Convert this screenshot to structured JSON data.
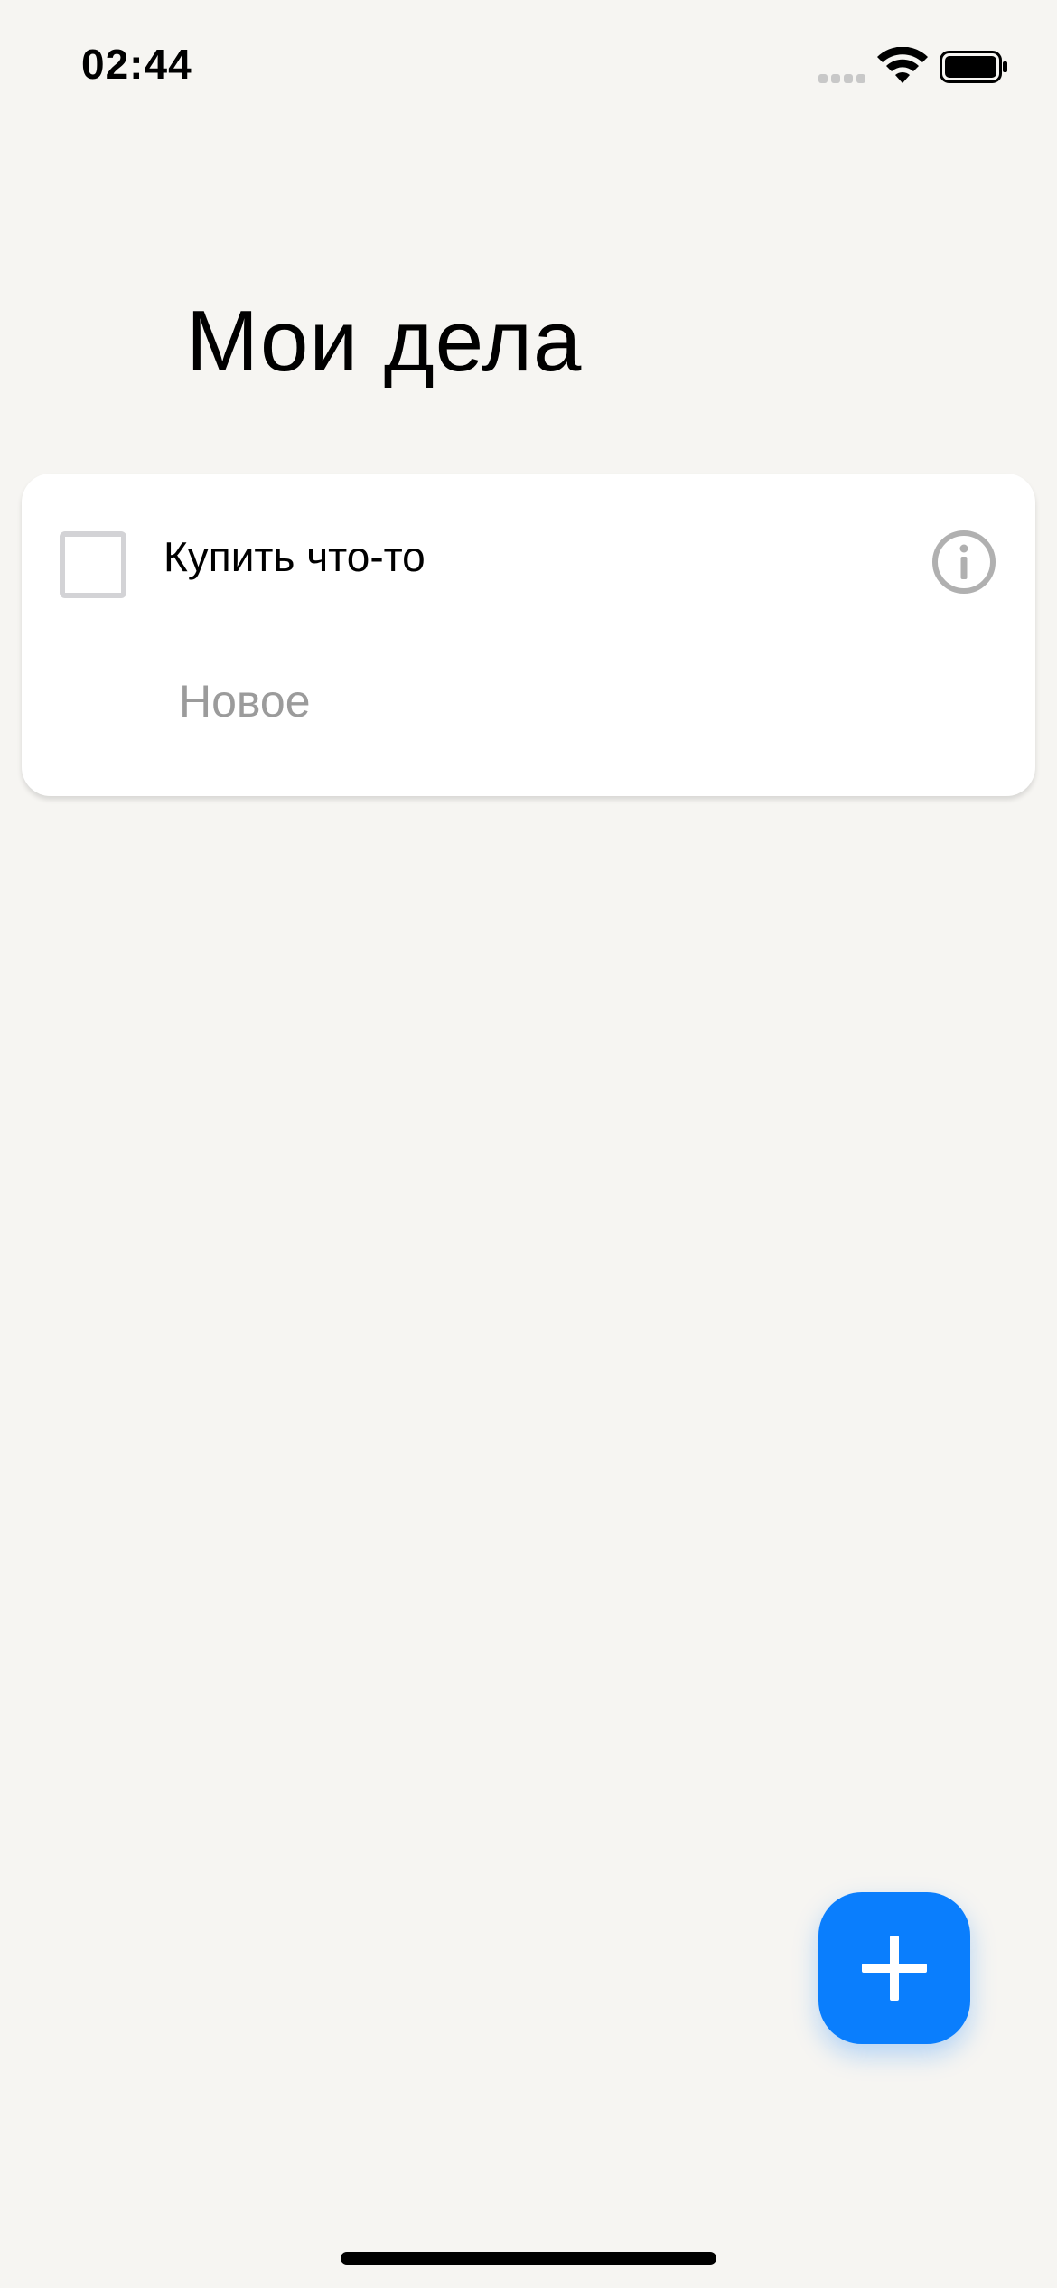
{
  "status_bar": {
    "time": "02:44",
    "icons": [
      "cellular-signal-icon",
      "wifi-icon",
      "battery-icon"
    ]
  },
  "header": {
    "title": "Мои дела"
  },
  "task_list": {
    "items": [
      {
        "label": "Купить что-то",
        "completed": false,
        "icons": [
          "checkbox-icon",
          "info-icon"
        ]
      }
    ],
    "new_item_placeholder": "Новое"
  },
  "fab": {
    "icon": "plus-icon"
  },
  "colors": {
    "background": "#f6f5f2",
    "card": "#ffffff",
    "accent": "#0a7efd",
    "placeholder": "#9b9b9b",
    "checkbox_border": "#d3d3d6"
  }
}
